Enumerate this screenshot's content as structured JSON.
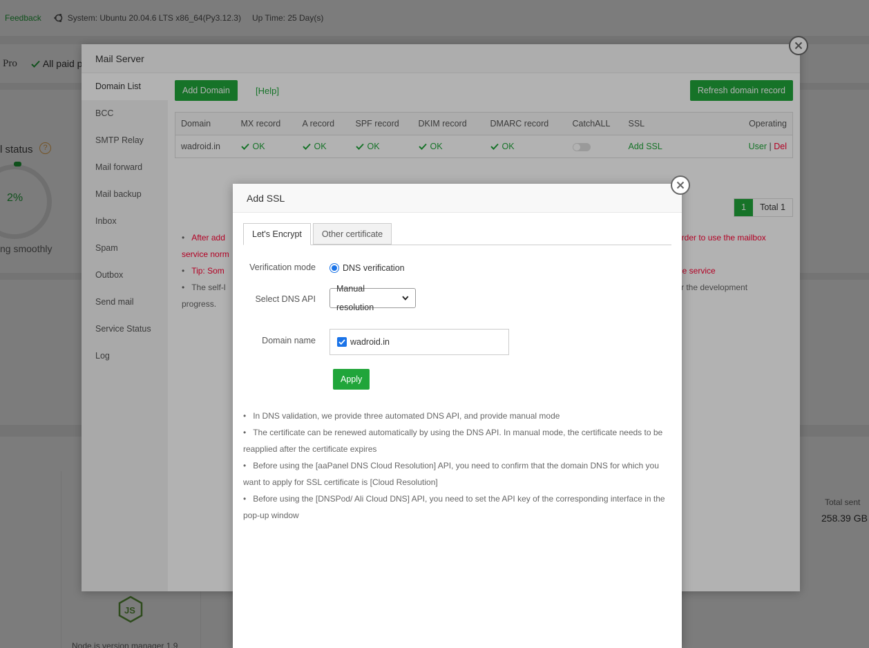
{
  "topbar": {
    "feedback": "Feedback",
    "system": "System: Ubuntu 20.04.6 LTS x86_64(Py3.12.3)",
    "uptime": "Up Time: 25 Day(s)"
  },
  "background": {
    "pro": "Pro",
    "paid": "All paid pl",
    "status_title": "l status",
    "gauge_value": "2%",
    "gauge_label": "ng smoothly",
    "total_sent_label": "Total sent",
    "total_sent_value": "258.39 GB",
    "node_label": "Node.js version manager 1.9"
  },
  "mail_server": {
    "title": "Mail Server",
    "sidebar": [
      "Domain List",
      "BCC",
      "SMTP Relay",
      "Mail forward",
      "Mail backup",
      "Inbox",
      "Spam",
      "Outbox",
      "Send mail",
      "Service Status",
      "Log"
    ],
    "add_domain": "Add Domain",
    "help": "[Help]",
    "refresh": "Refresh domain record",
    "table": {
      "headers": [
        "Domain",
        "MX record",
        "A record",
        "SPF record",
        "DKIM record",
        "DMARC record",
        "CatchALL",
        "SSL",
        "Operating"
      ],
      "row": {
        "domain": "wadroid.in",
        "mx": "OK",
        "a": "OK",
        "spf": "OK",
        "dkim": "OK",
        "dmarc": "OK",
        "ssl": "Add SSL",
        "user": "User",
        "sep": "|",
        "del": "Del"
      }
    },
    "pager": {
      "current": "1",
      "total": "Total 1"
    },
    "tips": {
      "t1_start": "After add",
      "t1_end": "order to use the mailbox",
      "t1_cont": "service norm",
      "t2_start": "Tip: Som",
      "t2_end": "ice service",
      "t3_start": "The self-l",
      "t3_end": "for the development",
      "t3_cont": "progress."
    }
  },
  "add_ssl": {
    "title": "Add SSL",
    "tabs": [
      "Let's Encrypt",
      "Other certificate"
    ],
    "verification_label": "Verification mode",
    "verification_value": "DNS verification",
    "dns_api_label": "Select DNS API",
    "dns_api_value": "Manual resolution",
    "domain_label": "Domain name",
    "domain_value": "wadroid.in",
    "apply": "Apply",
    "tips": [
      "In DNS validation, we provide three automated DNS API, and provide manual mode",
      "The certificate can be renewed automatically by using the DNS API. In manual mode, the certificate needs to be reapplied after the certificate expires",
      "Before using the [aaPanel DNS Cloud Resolution] API, you need to confirm that the domain DNS for which you want to apply for SSL certificate is [Cloud Resolution]",
      "Before using the [DNSPod/ Ali Cloud DNS] API, you need to set the API key of the corresponding interface in the pop-up window"
    ]
  },
  "colors": {
    "accent": "#20a53a",
    "danger": "#ff0033",
    "radio": "#1a73e8"
  }
}
